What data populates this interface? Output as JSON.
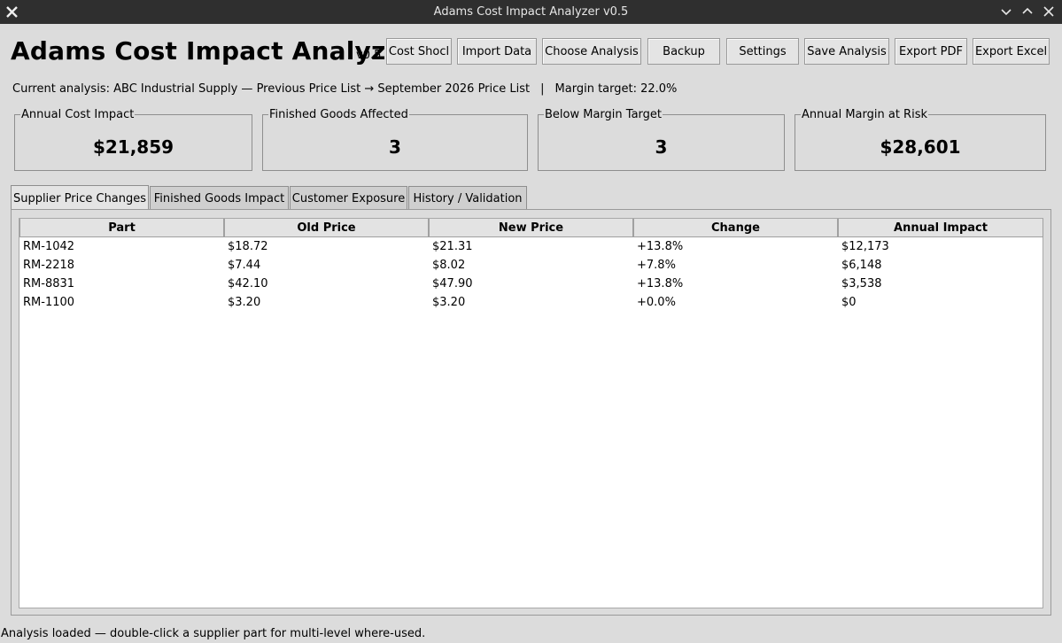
{
  "window": {
    "title": "Adams Cost Impact Analyzer v0.5"
  },
  "header": {
    "title": "Adams Cost Impact Analyzer",
    "version": "v0.5"
  },
  "toolbar": {
    "buttons": [
      "Cost Shocl",
      "Import Data",
      "Choose Analysis",
      "Backup",
      "Settings",
      "Save Analysis",
      "Export PDF",
      "Export Excel"
    ]
  },
  "info": {
    "current_analysis": "Current analysis: ABC Industrial Supply — Previous Price List → September 2026 Price List",
    "separator": "|",
    "margin_target": "Margin target: 22.0%"
  },
  "cards": [
    {
      "label": "Annual Cost Impact",
      "value": "$21,859"
    },
    {
      "label": "Finished Goods Affected",
      "value": "3"
    },
    {
      "label": "Below Margin Target",
      "value": "3"
    },
    {
      "label": "Annual Margin at Risk",
      "value": "$28,601"
    }
  ],
  "tabs": [
    "Supplier Price Changes",
    "Finished Goods Impact",
    "Customer Exposure",
    "History / Validation"
  ],
  "table": {
    "columns": [
      "Part",
      "Old Price",
      "New Price",
      "Change",
      "Annual Impact"
    ],
    "rows": [
      [
        "RM-1042",
        "$18.72",
        "$21.31",
        "+13.8%",
        "$12,173"
      ],
      [
        "RM-2218",
        "$7.44",
        "$8.02",
        "+7.8%",
        "$6,148"
      ],
      [
        "RM-8831",
        "$42.10",
        "$47.90",
        "+13.8%",
        "$3,538"
      ],
      [
        "RM-1100",
        "$3.20",
        "$3.20",
        "+0.0%",
        "$0"
      ]
    ]
  },
  "status": {
    "text": "Analysis loaded — double-click a supplier part for multi-level where-used."
  }
}
